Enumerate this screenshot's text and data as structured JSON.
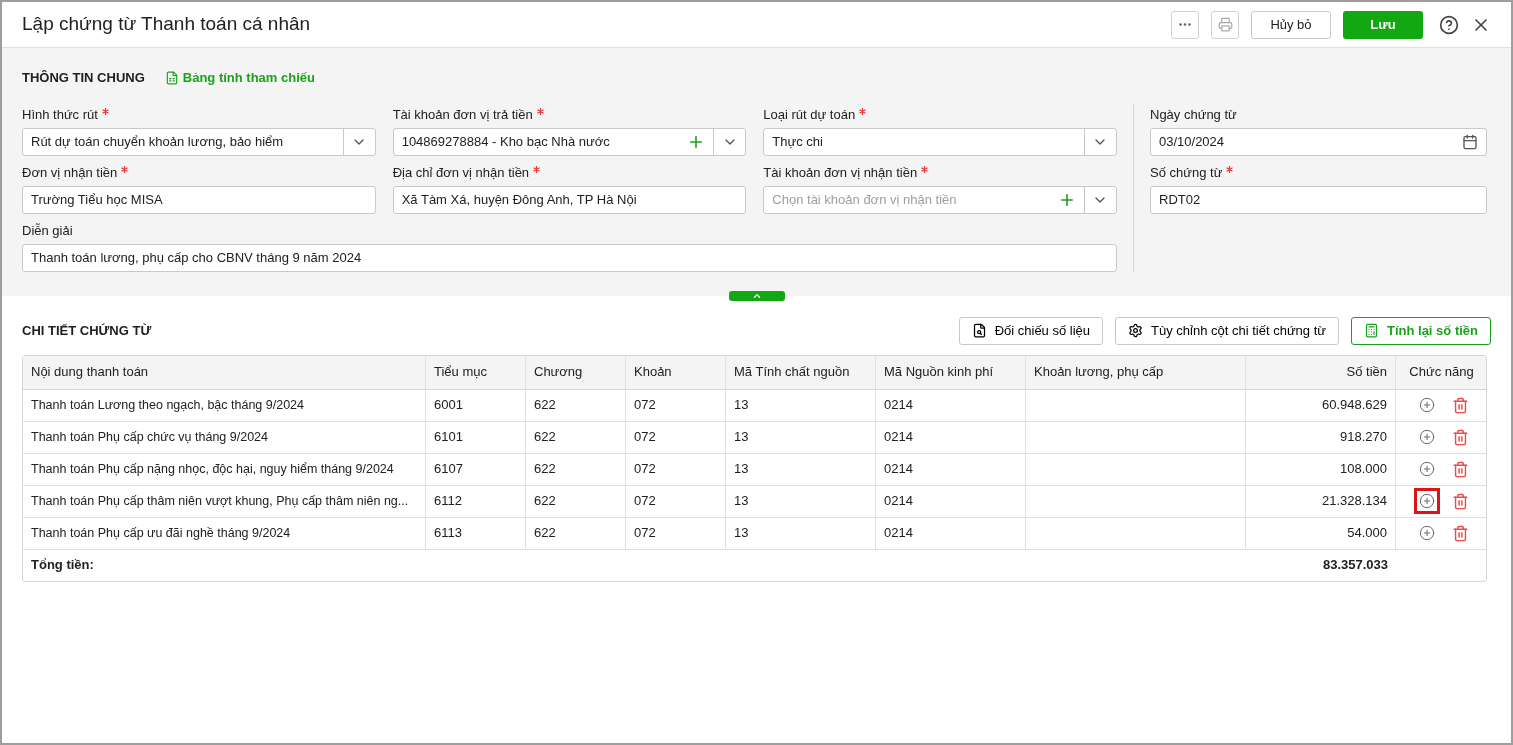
{
  "window": {
    "title": "Lập chứng từ Thanh toán cá nhân"
  },
  "toolbar": {
    "cancel": "Hủy bỏ",
    "save": "Lưu"
  },
  "general": {
    "title": "THÔNG TIN CHUNG",
    "reference_link": "Bảng tính tham chiếu"
  },
  "fields": [
    {
      "label": "Hình thức rút",
      "required": true,
      "kind": "select",
      "value": "Rút dự toán chuyển khoản lương, bảo hiểm"
    },
    {
      "label": "Tài khoản đơn vị trả tiền",
      "required": true,
      "kind": "select-add",
      "value": "104869278884 - Kho bạc Nhà nước"
    },
    {
      "label": "Loại rút dự toán",
      "required": true,
      "kind": "select",
      "value": "Thực chi"
    },
    {
      "label": "Đơn vị nhận tiền",
      "required": true,
      "kind": "text",
      "value": "Trường Tiểu học MISA"
    },
    {
      "label": "Địa chỉ đơn vị nhận tiền",
      "required": true,
      "kind": "text",
      "value": "Xã Tàm Xá, huyện Đông Anh, TP Hà Nội"
    },
    {
      "label": "Tài khoản đơn vị nhận tiền",
      "required": true,
      "kind": "select-add",
      "placeholder": "Chọn tài khoản đơn vị nhận tiền"
    },
    {
      "label": "Diễn giải",
      "required": false,
      "kind": "wide",
      "value": "Thanh toán lương, phụ cấp cho CBNV tháng 9 năm 2024"
    }
  ],
  "side_fields": [
    {
      "label": "Ngày chứng từ",
      "required": false,
      "kind": "date",
      "value": "03/10/2024"
    },
    {
      "label": "Số chứng từ",
      "required": true,
      "kind": "text",
      "value": "RDT02"
    }
  ],
  "detail": {
    "title": "CHI TIẾT CHỨNG TỪ",
    "buttons": [
      "Đối chiếu số liệu",
      "Tùy chỉnh cột chi tiết chứng từ"
    ],
    "recalc": "Tính lại số tiền"
  },
  "table": {
    "columns": [
      "Nội dung thanh toán",
      "Tiểu mục",
      "Chương",
      "Khoản",
      "Mã Tính chất nguồn",
      "Mã Nguồn kinh phí",
      "Khoản lương, phụ cấp",
      "Số tiền",
      "Chức năng"
    ],
    "rows": [
      {
        "cells": [
          "Thanh toán Lương theo ngạch, bậc tháng 9/2024",
          "6001",
          "622",
          "072",
          "13",
          "0214",
          "",
          "60.948.629"
        ],
        "highlighted": false
      },
      {
        "cells": [
          "Thanh toán Phụ cấp chức vụ tháng 9/2024",
          "6101",
          "622",
          "072",
          "13",
          "0214",
          "",
          "918.270"
        ],
        "highlighted": false
      },
      {
        "cells": [
          "Thanh toán Phụ cấp nặng nhọc, độc hại, nguy hiểm tháng 9/2024",
          "6107",
          "622",
          "072",
          "13",
          "0214",
          "",
          "108.000"
        ],
        "highlighted": false
      },
      {
        "cells": [
          "Thanh toán Phụ cấp thâm niên vượt khung, Phụ cấp thâm niên ng...",
          "6112",
          "622",
          "072",
          "13",
          "0214",
          "",
          "21.328.134"
        ],
        "highlighted": true
      },
      {
        "cells": [
          "Thanh toán Phụ cấp ưu đãi nghề tháng 9/2024",
          "6113",
          "622",
          "072",
          "13",
          "0214",
          "",
          "54.000"
        ],
        "highlighted": false
      }
    ],
    "total_label": "Tổng tiền:",
    "total": "83.357.033"
  }
}
